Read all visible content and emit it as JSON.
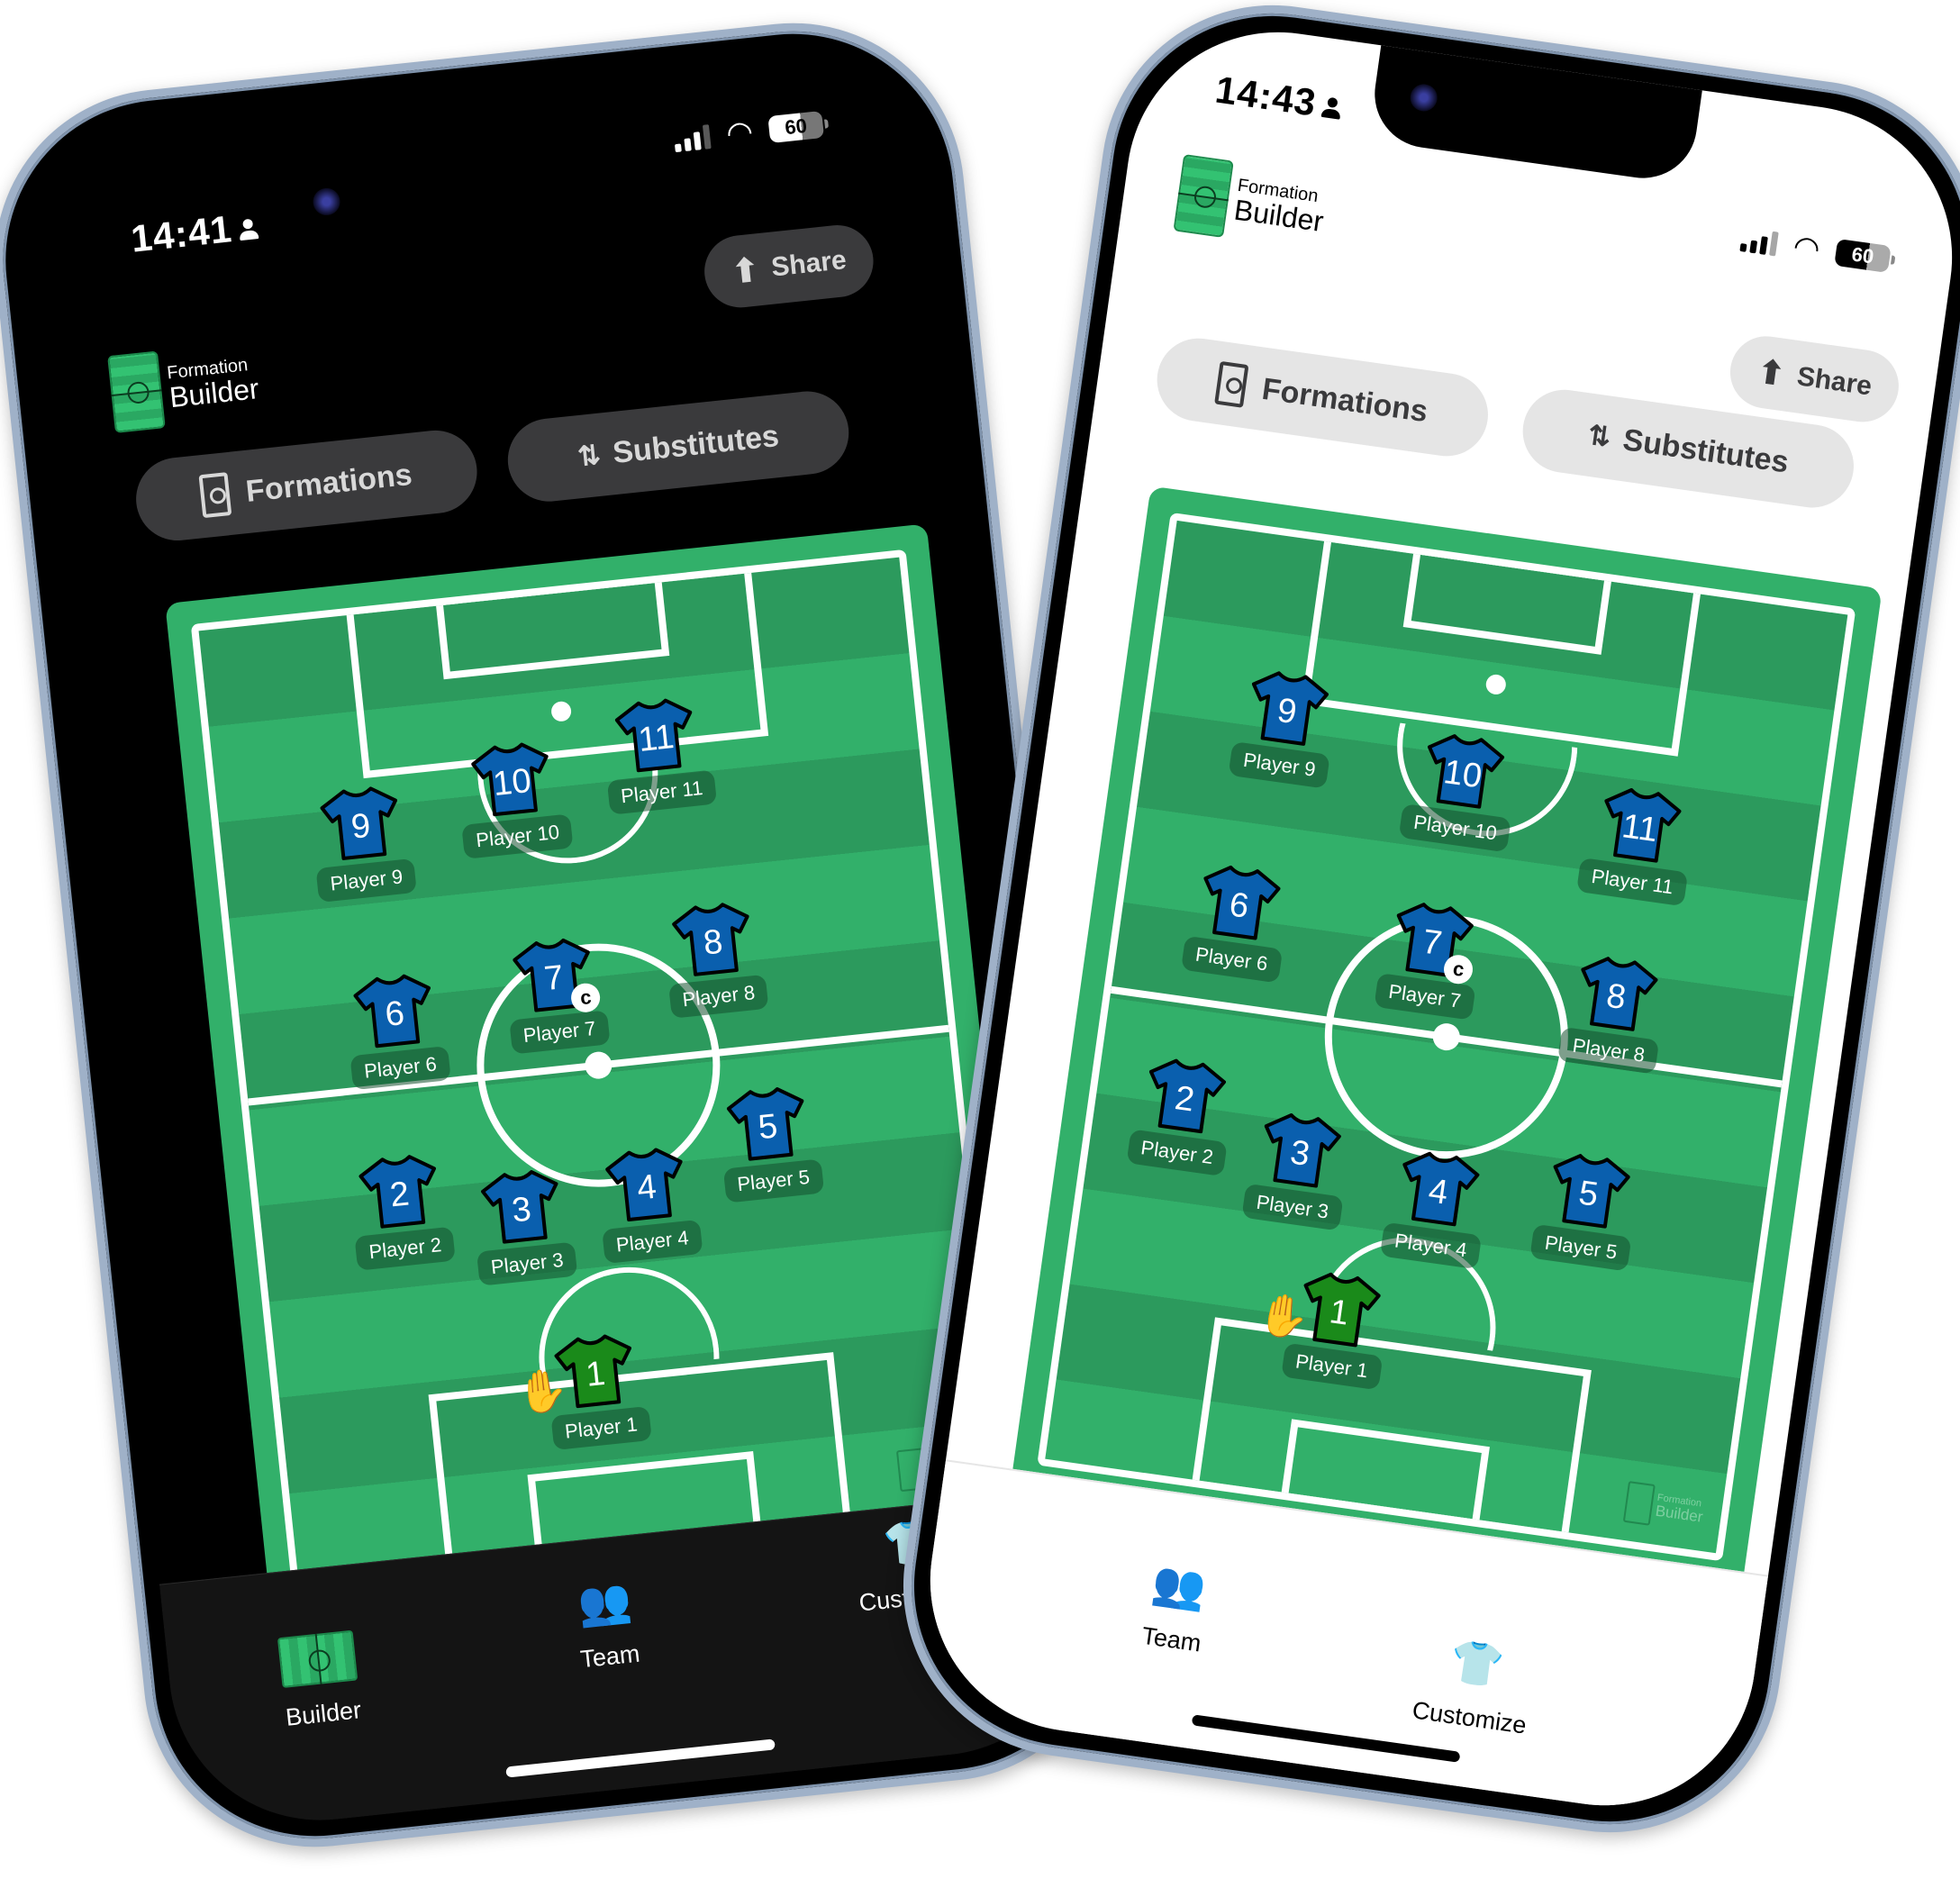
{
  "app": {
    "name_small": "Formation",
    "name_big": "Builder",
    "share_label": "Share",
    "formations_label": "Formations",
    "substitutes_label": "Substitutes",
    "watermark_small": "Formation",
    "watermark_big": "Builder"
  },
  "phones": [
    {
      "theme": "dark",
      "time": "14:41",
      "battery": "60",
      "tabs": [
        {
          "label": "Builder",
          "icon": "pitch-icon",
          "active": true
        },
        {
          "label": "Team",
          "icon": "team-icon",
          "active": false
        },
        {
          "label": "Customize",
          "icon": "shirt-brush-icon",
          "active": false
        }
      ]
    },
    {
      "theme": "light",
      "time": "14:43",
      "battery": "60",
      "tabs": [
        {
          "label": "Team",
          "icon": "team-icon",
          "active": false
        },
        {
          "label": "Customize",
          "icon": "shirt-brush-icon",
          "active": false
        }
      ]
    }
  ],
  "formation": {
    "outfield_color": "#0a5fae",
    "goalkeeper_color": "#1a8a1a",
    "captain_marker": "C",
    "players": [
      {
        "number": "1",
        "name": "Player 1",
        "role": "goalkeeper"
      },
      {
        "number": "2",
        "name": "Player 2"
      },
      {
        "number": "3",
        "name": "Player 3"
      },
      {
        "number": "4",
        "name": "Player 4"
      },
      {
        "number": "5",
        "name": "Player 5"
      },
      {
        "number": "6",
        "name": "Player 6"
      },
      {
        "number": "7",
        "name": "Player 7",
        "captain": true
      },
      {
        "number": "8",
        "name": "Player 8"
      },
      {
        "number": "9",
        "name": "Player 9"
      },
      {
        "number": "10",
        "name": "Player 10"
      },
      {
        "number": "11",
        "name": "Player 11"
      }
    ]
  },
  "colors": {
    "pitch_light": "#32b06a",
    "pitch_dark": "#2c9a5d",
    "pill_dark": "#3a3a3c",
    "pill_light": "#e5e5e5"
  }
}
